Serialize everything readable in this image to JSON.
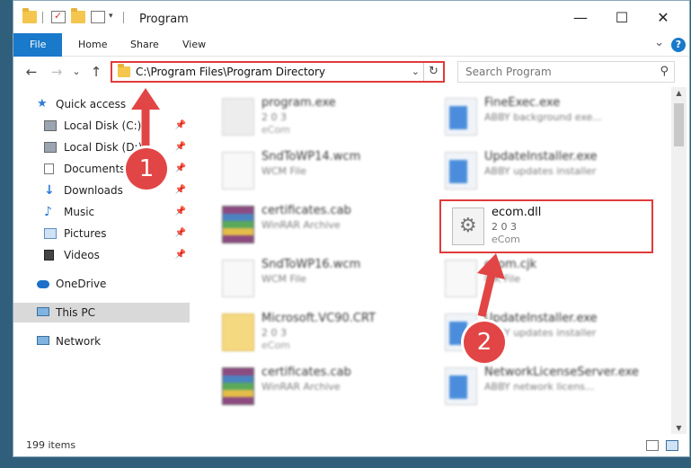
{
  "window": {
    "title": "Program",
    "controls": {
      "minimize": "—",
      "maximize": "☐",
      "close": "✕"
    }
  },
  "ribbon": {
    "tabs": [
      "File",
      "Home",
      "Share",
      "View"
    ],
    "help": "?"
  },
  "nav": {
    "back": "←",
    "forward": "→",
    "recent": "⌄",
    "up": "↑",
    "address": "C:\\Program Files\\Program Directory",
    "refresh": "↻",
    "search_placeholder": "Search Program"
  },
  "sidebar": {
    "items": [
      {
        "label": "Quick access",
        "icon": "star-icon",
        "pinned": false
      },
      {
        "label": "Local Disk (C:)",
        "icon": "disk-icon",
        "pinned": true
      },
      {
        "label": "Local Disk (D:)",
        "icon": "disk-icon",
        "pinned": true
      },
      {
        "label": "Documents",
        "icon": "documents-icon",
        "pinned": true
      },
      {
        "label": "Downloads",
        "icon": "download-icon",
        "pinned": true
      },
      {
        "label": "Music",
        "icon": "music-icon",
        "pinned": true
      },
      {
        "label": "Pictures",
        "icon": "pictures-icon",
        "pinned": true
      },
      {
        "label": "Videos",
        "icon": "videos-icon",
        "pinned": true
      },
      {
        "label": "OneDrive",
        "icon": "cloud-icon",
        "pinned": false
      },
      {
        "label": "This PC",
        "icon": "computer-icon",
        "pinned": false
      },
      {
        "label": "Network",
        "icon": "network-icon",
        "pinned": false
      }
    ],
    "pin_glyph": "📌"
  },
  "files": [
    {
      "name": "program.exe",
      "line1": "2 0 3",
      "line2": "eCom"
    },
    {
      "name": "FineExec.exe",
      "line1": "ABBY background exe...",
      "line2": ""
    },
    {
      "name": "SndToWP14.wcm",
      "line1": "WCM File",
      "line2": ""
    },
    {
      "name": "UpdateInstaller.exe",
      "line1": "ABBY updates installer",
      "line2": ""
    },
    {
      "name": "certificates.cab",
      "line1": "WinRAR Archive",
      "line2": ""
    },
    {
      "name": "ecom.dll",
      "line1": "2 0 3",
      "line2": "eCom"
    },
    {
      "name": "SndToWP16.wcm",
      "line1": "WCM File",
      "line2": ""
    },
    {
      "name": "ecom.cjk",
      "line1": "CJK File",
      "line2": ""
    },
    {
      "name": "Microsoft.VC90.CRT",
      "line1": "2 0 3",
      "line2": "eCom"
    },
    {
      "name": "UpdateInstaller.exe",
      "line1": "ABBY updates installer",
      "line2": ""
    },
    {
      "name": "certificates.cab",
      "line1": "WinRAR Archive",
      "line2": ""
    },
    {
      "name": "NetworkLicenseServer.exe",
      "line1": "ABBY network licens...",
      "line2": ""
    }
  ],
  "status": {
    "count": "199 items"
  },
  "annotations": {
    "step1": "1",
    "step2": "2"
  },
  "colors": {
    "accent": "#1979ca",
    "highlight": "#e03b3b",
    "annotation": "#e24545"
  }
}
